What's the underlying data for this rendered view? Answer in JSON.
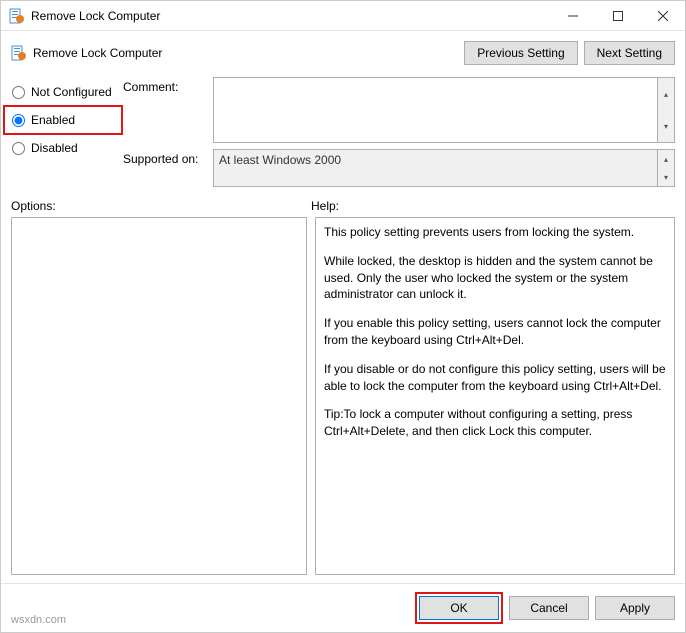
{
  "window": {
    "title": "Remove Lock Computer",
    "header_title": "Remove Lock Computer"
  },
  "nav": {
    "previous": "Previous Setting",
    "next": "Next Setting"
  },
  "state": {
    "not_configured_label": "Not Configured",
    "enabled_label": "Enabled",
    "disabled_label": "Disabled"
  },
  "labels": {
    "comment": "Comment:",
    "supported": "Supported on:",
    "options": "Options:",
    "help": "Help:"
  },
  "fields": {
    "comment_value": "",
    "supported_value": "At least Windows 2000"
  },
  "help": {
    "p1": "This policy setting prevents users from locking the system.",
    "p2": "While locked, the desktop is hidden and the system cannot be used. Only the user who locked the system or the system administrator can unlock it.",
    "p3": "If you enable this policy setting, users cannot lock the computer from the keyboard using Ctrl+Alt+Del.",
    "p4": "If you disable or do not configure this policy setting, users will be able to lock the computer from the keyboard using Ctrl+Alt+Del.",
    "p5": "Tip:To lock a computer without configuring a setting, press Ctrl+Alt+Delete, and then click Lock this computer."
  },
  "footer": {
    "ok": "OK",
    "cancel": "Cancel",
    "apply": "Apply"
  },
  "watermark": "wsxdn.com"
}
